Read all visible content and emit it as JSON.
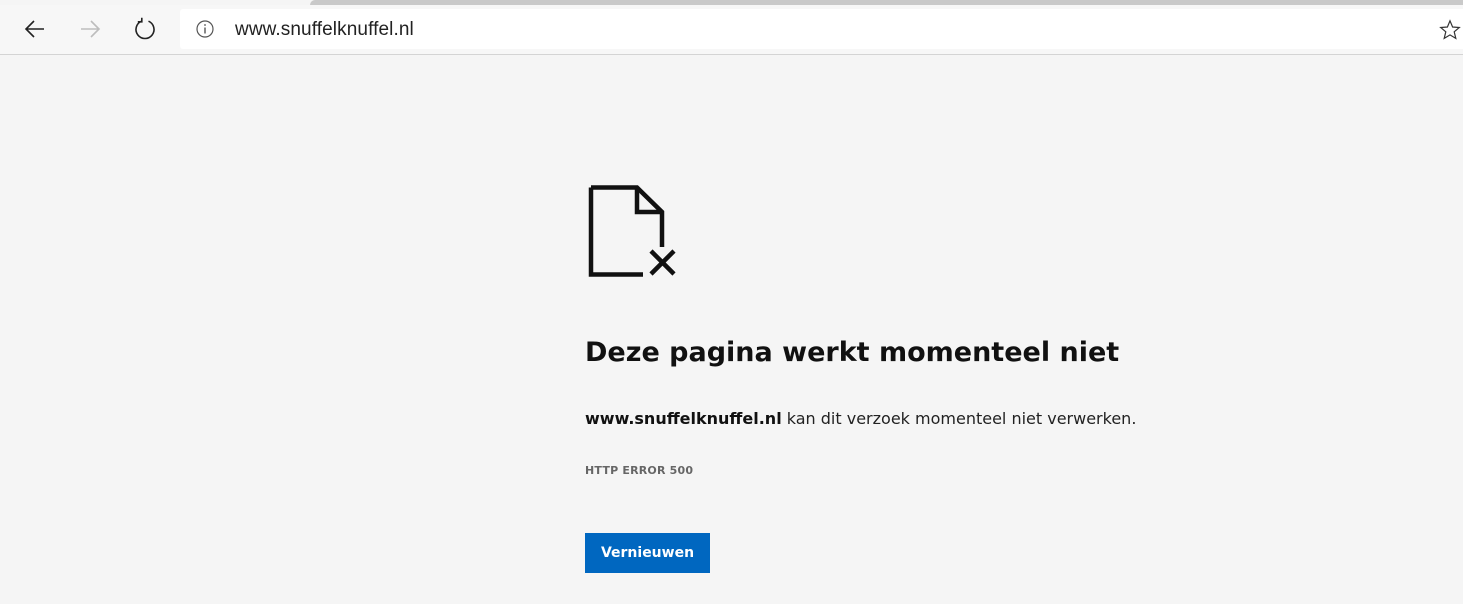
{
  "browser": {
    "address_bar": {
      "url": "www.snuffelknuffel.nl"
    },
    "icons": {
      "back": "back-arrow-icon",
      "forward": "forward-arrow-icon",
      "reload": "refresh-icon",
      "info": "info-icon",
      "favorite": "star-icon"
    }
  },
  "error_page": {
    "icon": "broken-document-icon",
    "title": "Deze pagina werkt momenteel niet",
    "description_host": "www.snuffelknuffel.nl",
    "description_text": " kan dit verzoek momenteel niet verwerken.",
    "error_code": "HTTP ERROR 500",
    "reload_button": "Vernieuwen"
  },
  "colors": {
    "accent": "#0067c0",
    "page_background": "#f5f5f5"
  }
}
